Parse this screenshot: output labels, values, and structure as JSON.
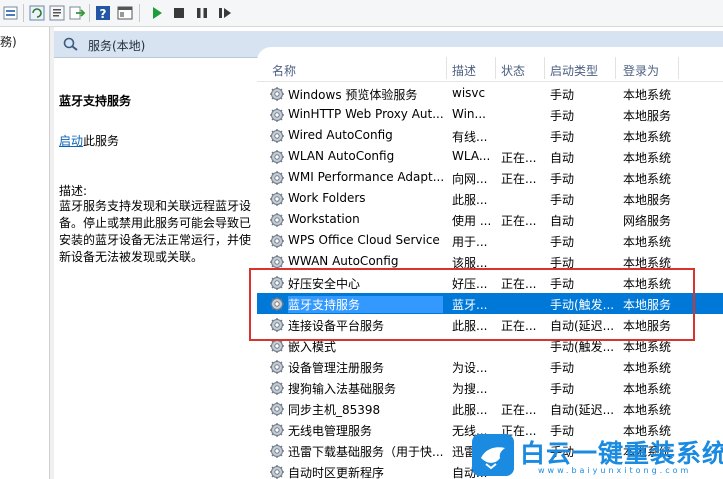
{
  "window": {
    "left_pane_fragment": "務)"
  },
  "header": {
    "title": "服务(本地)"
  },
  "description_panel": {
    "service_name": "蓝牙支持服务",
    "start_link": "启动",
    "start_suffix": "此服务",
    "label": "描述:",
    "text": "蓝牙服务支持发现和关联远程蓝牙设备。停止或禁用此服务可能会导致已安装的蓝牙设备无法正常运行，并使新设备无法被发现或关联。"
  },
  "columns": {
    "name": "名称",
    "description": "描述",
    "status": "状态",
    "startup_type": "启动类型",
    "logon_as": "登录为"
  },
  "services": [
    {
      "name": "Windows 预览体验服务",
      "description": "wisvc",
      "status": "",
      "startup": "手动",
      "logon": "本地系统"
    },
    {
      "name": "WinHTTP Web Proxy Aut...",
      "description": "Win...",
      "status": "",
      "startup": "手动",
      "logon": "本地服务"
    },
    {
      "name": "Wired AutoConfig",
      "description": "有线...",
      "status": "",
      "startup": "手动",
      "logon": "本地系统"
    },
    {
      "name": "WLAN AutoConfig",
      "description": "WLA...",
      "status": "正在...",
      "startup": "自动",
      "logon": "本地系统"
    },
    {
      "name": "WMI Performance Adapt...",
      "description": "向网...",
      "status": "正在...",
      "startup": "手动",
      "logon": "本地系统"
    },
    {
      "name": "Work Folders",
      "description": "此服...",
      "status": "",
      "startup": "手动",
      "logon": "本地服务"
    },
    {
      "name": "Workstation",
      "description": "使用 ...",
      "status": "正在...",
      "startup": "自动",
      "logon": "网络服务"
    },
    {
      "name": "WPS Office Cloud Service",
      "description": "用于...",
      "status": "",
      "startup": "手动",
      "logon": "本地系统"
    },
    {
      "name": "WWAN AutoConfig",
      "description": "该服...",
      "status": "",
      "startup": "手动",
      "logon": "本地系统"
    },
    {
      "name": "好压安全中心",
      "description": "好压...",
      "status": "正在...",
      "startup": "手动",
      "logon": "本地系统"
    },
    {
      "name": "蓝牙支持服务",
      "description": "蓝牙...",
      "status": "",
      "startup": "手动(触发...",
      "logon": "本地服务",
      "selected": true
    },
    {
      "name": "连接设备平台服务",
      "description": "此服...",
      "status": "正在...",
      "startup": "自动(延迟...",
      "logon": "本地服务"
    },
    {
      "name": "嵌入模式",
      "description": "",
      "status": "",
      "startup": "手动(触发...",
      "logon": "本地系统"
    },
    {
      "name": "设备管理注册服务",
      "description": "为设...",
      "status": "",
      "startup": "手动",
      "logon": "本地系统"
    },
    {
      "name": "搜狗输入法基础服务",
      "description": "为搜...",
      "status": "",
      "startup": "手动",
      "logon": "本地系统"
    },
    {
      "name": "同步主机_85398",
      "description": "此服...",
      "status": "正在...",
      "startup": "自动(延迟...",
      "logon": "本地系统"
    },
    {
      "name": "无线电管理服务",
      "description": "无线...",
      "status": "正在...",
      "startup": "手动",
      "logon": "本地系统"
    },
    {
      "name": "迅雷下载基础服务（用于快...",
      "description": "迅雷...",
      "status": "",
      "startup": "手动",
      "logon": "本地系统"
    },
    {
      "name": "自动时区更新程序",
      "description": "自动...",
      "status": "",
      "startup": "",
      "logon": ""
    }
  ],
  "watermark": {
    "title": "白云一键重装系统",
    "url": "www.baiyunxitong.com"
  },
  "colors": {
    "selection": "#0078d7",
    "header_bg": "#d7e3f0",
    "highlight_border": "#d9342b",
    "link": "#0b62b5"
  }
}
